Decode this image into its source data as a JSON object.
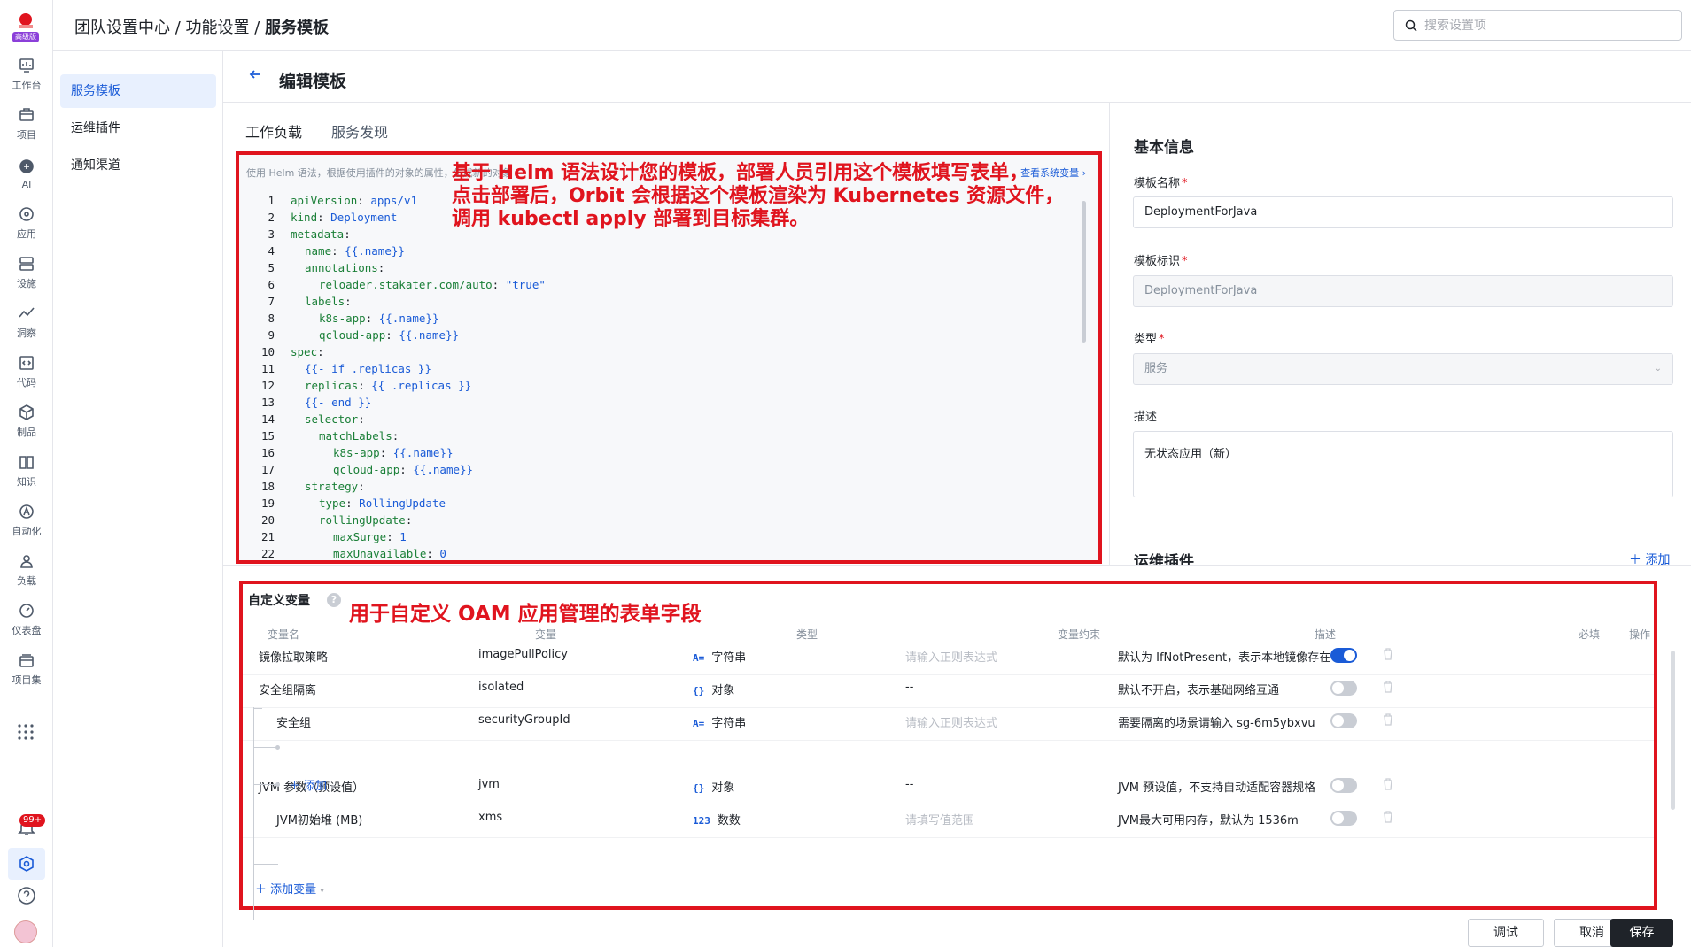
{
  "brand": {
    "badge": "高级版"
  },
  "rail": [
    {
      "label": "工作台",
      "icon": "dashboard-icon"
    },
    {
      "label": "项目",
      "icon": "project-icon"
    },
    {
      "label": "AI",
      "icon": "ai-icon"
    },
    {
      "label": "应用",
      "icon": "app-icon"
    },
    {
      "label": "设施",
      "icon": "infrastructure-icon"
    },
    {
      "label": "洞察",
      "icon": "insight-icon"
    },
    {
      "label": "代码",
      "icon": "code-icon"
    },
    {
      "label": "制品",
      "icon": "artifact-icon"
    },
    {
      "label": "知识",
      "icon": "knowledge-icon"
    },
    {
      "label": "自动化",
      "icon": "automation-icon"
    },
    {
      "label": "负载",
      "icon": "workload-icon"
    },
    {
      "label": "仪表盘",
      "icon": "gauge-icon"
    },
    {
      "label": "项目集",
      "icon": "program-icon"
    }
  ],
  "notifications": {
    "badge": "99+"
  },
  "header": {
    "crumb1": "团队设置中心",
    "crumb2": "功能设置",
    "crumb3": "服务模板",
    "search_placeholder": "搜索设置项"
  },
  "submenu": [
    "服务模板",
    "运维插件",
    "通知渠道"
  ],
  "page": {
    "title": "编辑模板"
  },
  "tabs": [
    "工作负载",
    "服务发现"
  ],
  "editor": {
    "hint": "使用 Helm 语法，根据使用插件的对象的属性，生成新的对象",
    "sysvar_link": "查看系统变量",
    "annotation_line1": "基于 Helm 语法设计您的模板，部署人员引用这个模板填写表单，",
    "annotation_line2": "点击部署后，Orbit 会根据这个模板渲染为 Kubernetes 资源文件，",
    "annotation_line3": "调用 kubectl apply 部署到目标集群。",
    "lines": [
      {
        "n": "1",
        "i": 0,
        "k": "apiVersion",
        "v": "apps/v1"
      },
      {
        "n": "2",
        "i": 0,
        "k": "kind",
        "v": "Deployment"
      },
      {
        "n": "3",
        "i": 0,
        "k": "metadata",
        "v": ""
      },
      {
        "n": "4",
        "i": 1,
        "k": "name",
        "v": "{{.name}}"
      },
      {
        "n": "5",
        "i": 1,
        "k": "annotations",
        "v": ""
      },
      {
        "n": "6",
        "i": 2,
        "k": "reloader.stakater.com/auto",
        "v": "\"true\""
      },
      {
        "n": "7",
        "i": 1,
        "k": "labels",
        "v": ""
      },
      {
        "n": "8",
        "i": 2,
        "k": "k8s-app",
        "v": "{{.name}}"
      },
      {
        "n": "9",
        "i": 2,
        "k": "qcloud-app",
        "v": "{{.name}}"
      },
      {
        "n": "10",
        "i": 0,
        "k": "spec",
        "v": ""
      },
      {
        "n": "11",
        "i": 1,
        "k": "",
        "v": "{{- if .replicas }}"
      },
      {
        "n": "12",
        "i": 1,
        "k": "replicas",
        "v": "{{ .replicas }}"
      },
      {
        "n": "13",
        "i": 1,
        "k": "",
        "v": "{{- end }}"
      },
      {
        "n": "14",
        "i": 1,
        "k": "selector",
        "v": ""
      },
      {
        "n": "15",
        "i": 2,
        "k": "matchLabels",
        "v": ""
      },
      {
        "n": "16",
        "i": 3,
        "k": "k8s-app",
        "v": "{{.name}}"
      },
      {
        "n": "17",
        "i": 3,
        "k": "qcloud-app",
        "v": "{{.name}}"
      },
      {
        "n": "18",
        "i": 1,
        "k": "strategy",
        "v": ""
      },
      {
        "n": "19",
        "i": 2,
        "k": "type",
        "v": "RollingUpdate"
      },
      {
        "n": "20",
        "i": 2,
        "k": "rollingUpdate",
        "v": ""
      },
      {
        "n": "21",
        "i": 3,
        "k": "maxSurge",
        "v": "1"
      },
      {
        "n": "22",
        "i": 3,
        "k": "maxUnavailable",
        "v": "0"
      }
    ]
  },
  "basic": {
    "title": "基本信息",
    "name_label": "模板名称",
    "name_value": "DeploymentForJava",
    "id_label": "模板标识",
    "id_value": "DeploymentForJava",
    "type_label": "类型",
    "type_value": "服务",
    "desc_label": "描述",
    "desc_value": "无状态应用（新）"
  },
  "plugins": {
    "title": "运维插件",
    "add_label": "添加"
  },
  "variables": {
    "title": "自定义变量",
    "annotation": "用于自定义 OAM 应用管理的表单字段",
    "headers": [
      "变量名",
      "变量",
      "类型",
      "变量约束",
      "描述",
      "必填",
      "操作"
    ],
    "rows": [
      {
        "name": "镜像拉取策略",
        "var": "imagePullPolicy",
        "typeicon": "A=",
        "type": "字符串",
        "constraint": "请输入正则表达式",
        "constraint_placeholder": true,
        "desc": "默认为 IfNotPresent，表示本地镜像存在",
        "required": true
      },
      {
        "name": "安全组隔离",
        "var": "isolated",
        "typeicon": "{}",
        "type": "对象",
        "constraint": "--",
        "constraint_placeholder": false,
        "desc": "默认不开启，表示基础网络互通",
        "required": false
      },
      {
        "name": "安全组",
        "var": "securityGroupId",
        "typeicon": "A=",
        "type": "字符串",
        "constraint": "请输入正则表达式",
        "constraint_placeholder": true,
        "desc": "需要隔离的场景请输入 sg-6m5ybxvu",
        "required": false
      },
      {
        "name": "JVM 参数（预设值）",
        "var": "jvm",
        "typeicon": "{}",
        "type": "对象",
        "constraint": "--",
        "constraint_placeholder": false,
        "desc": "JVM 预设值，不支持自动适配容器规格",
        "required": false
      },
      {
        "name": "JVM初始堆 (MB)",
        "var": "xms",
        "typeicon": "123",
        "type": "数数",
        "constraint": "请填写值范围",
        "constraint_placeholder": true,
        "desc": "JVM最大可用内存，默认为 1536m",
        "required": false
      }
    ],
    "add_child_label": "添加",
    "add_var_label": "添加变量"
  },
  "footer": {
    "debug": "调试",
    "cancel": "取消",
    "save": "保存"
  },
  "colors": {
    "accent": "#1a5bd7",
    "annotation_red": "#e0141e",
    "primary_button": "#1f2329"
  }
}
